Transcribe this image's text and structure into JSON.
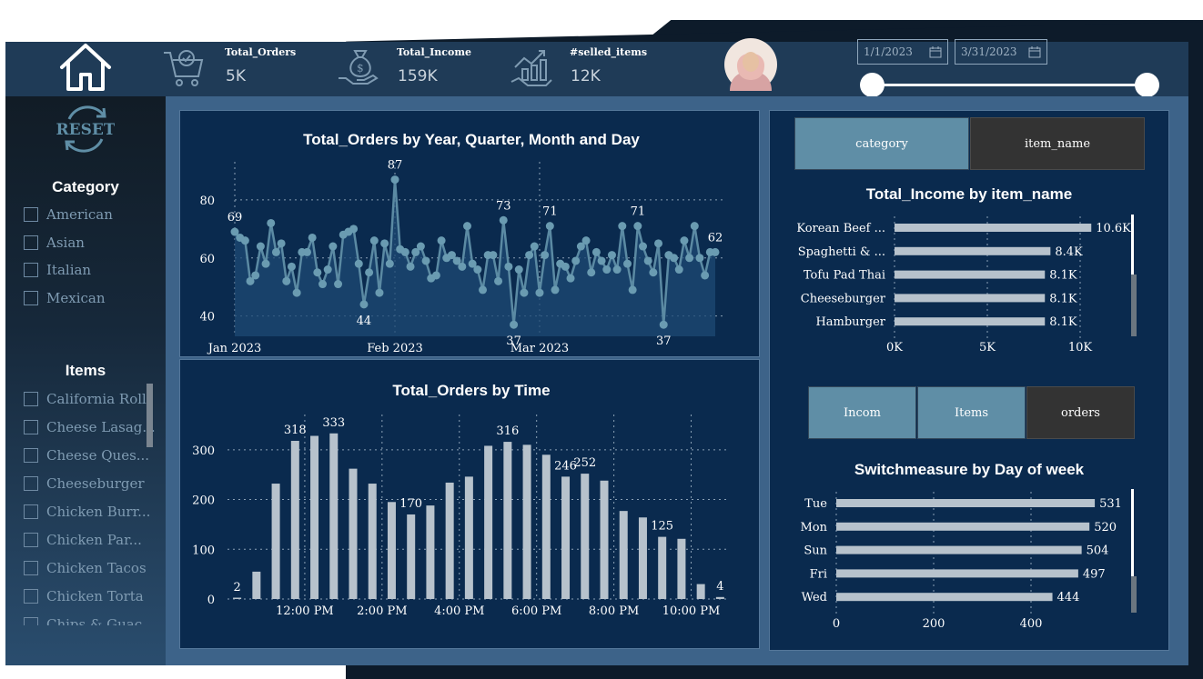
{
  "header": {
    "kpis": [
      {
        "label": "Total_Orders",
        "value": "5K",
        "icon": "delivery-cart-icon"
      },
      {
        "label": "Total_Income",
        "value": "159K",
        "icon": "money-bag-hand-icon"
      },
      {
        "label": "#selled_items",
        "value": "12K",
        "icon": "growth-money-icon"
      }
    ],
    "date_start": "1/1/2023",
    "date_end": "3/31/2023"
  },
  "sidebar": {
    "reset_label": "RESET",
    "category_title": "Category",
    "categories": [
      "American",
      "Asian",
      "Italian",
      "Mexican"
    ],
    "items_title": "Items",
    "items": [
      "California Roll",
      "Cheese Lasag...",
      "Cheese Ques...",
      "Cheeseburger",
      "Chicken Burr...",
      "Chicken Par...",
      "Chicken Tacos",
      "Chicken Torta",
      "Chips & Guac..."
    ]
  },
  "toggles": {
    "top": [
      "category",
      "item_name"
    ],
    "bottom": [
      "Incom",
      "Items",
      "orders"
    ]
  },
  "colors": {
    "accent": "#5f8ea6",
    "panel": "#0a2a4e",
    "bar": "#b7c2cc",
    "line": "#5b8aa3"
  },
  "chart_data": [
    {
      "type": "line",
      "title": "Total_Orders by Year, Quarter, Month and Day",
      "x_ticks": [
        "Jan 2023",
        "Feb 2023",
        "Mar 2023"
      ],
      "y_ticks": [
        "40",
        "60",
        "80"
      ],
      "ylim": [
        33,
        90
      ],
      "values": [
        69,
        67,
        66,
        52,
        54,
        64,
        58,
        72,
        62,
        65,
        52,
        57,
        48,
        62,
        62,
        67,
        55,
        51,
        56,
        64,
        51,
        68,
        69,
        70,
        58,
        44,
        55,
        66,
        48,
        65,
        58,
        87,
        63,
        62,
        57,
        62,
        64,
        59,
        53,
        54,
        66,
        60,
        61,
        59,
        57,
        71,
        58,
        56,
        49,
        61,
        61,
        52,
        73,
        57,
        37,
        56,
        48,
        61,
        64,
        48,
        61,
        71,
        49,
        58,
        57,
        53,
        59,
        64,
        66,
        55,
        62,
        59,
        56,
        61,
        56,
        71,
        58,
        49,
        71,
        64,
        59,
        55,
        65,
        37,
        61,
        60,
        56,
        66,
        60,
        71,
        60,
        54,
        62,
        62
      ],
      "point_labels": [
        {
          "i": 0,
          "text": "69"
        },
        {
          "i": 25,
          "text": "44"
        },
        {
          "i": 31,
          "text": "87"
        },
        {
          "i": 52,
          "text": "73"
        },
        {
          "i": 54,
          "text": "37"
        },
        {
          "i": 61,
          "text": "71"
        },
        {
          "i": 78,
          "text": "71"
        },
        {
          "i": 83,
          "text": "37"
        },
        {
          "i": 93,
          "text": "62"
        }
      ]
    },
    {
      "type": "bar",
      "title": "Total_Orders by Time",
      "categories": [
        "10:00 AM",
        "10:30 AM",
        "11:00 AM",
        "11:30 AM",
        "12:00 PM",
        "12:30 PM",
        "1:00 PM",
        "1:30 PM",
        "2:00 PM",
        "2:30 PM",
        "3:00 PM",
        "3:30 PM",
        "4:00 PM",
        "4:30 PM",
        "5:00 PM",
        "5:30 PM",
        "6:00 PM",
        "6:30 PM",
        "7:00 PM",
        "7:30 PM",
        "8:00 PM",
        "8:30 PM",
        "9:00 PM",
        "9:30 PM",
        "10:00 PM",
        "10:30 PM",
        "11:00 PM",
        "11:30 PM"
      ],
      "values": [
        2,
        55,
        232,
        318,
        328,
        333,
        262,
        232,
        195,
        170,
        188,
        234,
        246,
        308,
        316,
        310,
        290,
        246,
        252,
        238,
        177,
        164,
        125,
        121,
        30,
        4
      ],
      "x_tick_labels": [
        {
          "i": 3.5,
          "text": "12:00 PM"
        },
        {
          "i": 7.5,
          "text": "2:00 PM"
        },
        {
          "i": 11.5,
          "text": "4:00 PM"
        },
        {
          "i": 15.5,
          "text": "6:00 PM"
        },
        {
          "i": 19.5,
          "text": "8:00 PM"
        },
        {
          "i": 23.5,
          "text": "10:00 PM"
        }
      ],
      "bar_labels": [
        {
          "i": 0,
          "text": "2"
        },
        {
          "i": 3,
          "text": "318"
        },
        {
          "i": 5,
          "text": "333"
        },
        {
          "i": 9,
          "text": "170"
        },
        {
          "i": 14,
          "text": "316"
        },
        {
          "i": 17,
          "text": "246"
        },
        {
          "i": 18,
          "text": "252"
        },
        {
          "i": 22,
          "text": "125"
        },
        {
          "i": 25,
          "text": "4"
        }
      ],
      "y_ticks": [
        "0",
        "100",
        "200",
        "300"
      ],
      "ylim": [
        0,
        360
      ]
    },
    {
      "type": "bar",
      "orientation": "horizontal",
      "title": "Total_Income by item_name",
      "categories": [
        "Korean Beef ...",
        "Spaghetti & ...",
        "Tofu Pad Thai",
        "Cheeseburger",
        "Hamburger"
      ],
      "values": [
        10.6,
        8.4,
        8.1,
        8.1,
        8.1
      ],
      "value_labels": [
        "10.6K",
        "8.4K",
        "8.1K",
        "8.1K",
        "8.1K"
      ],
      "x_ticks": [
        "0K",
        "5K",
        "10K"
      ],
      "xlim": [
        0,
        10
      ]
    },
    {
      "type": "bar",
      "orientation": "horizontal",
      "title": "Switchmeasure by Day of week",
      "categories": [
        "Tue",
        "Mon",
        "Sun",
        "Fri",
        "Wed"
      ],
      "values": [
        531,
        520,
        504,
        497,
        444
      ],
      "value_labels": [
        "531",
        "520",
        "504",
        "497",
        "444"
      ],
      "x_ticks": [
        "0",
        "200",
        "400"
      ],
      "xlim": [
        0,
        400
      ]
    }
  ]
}
